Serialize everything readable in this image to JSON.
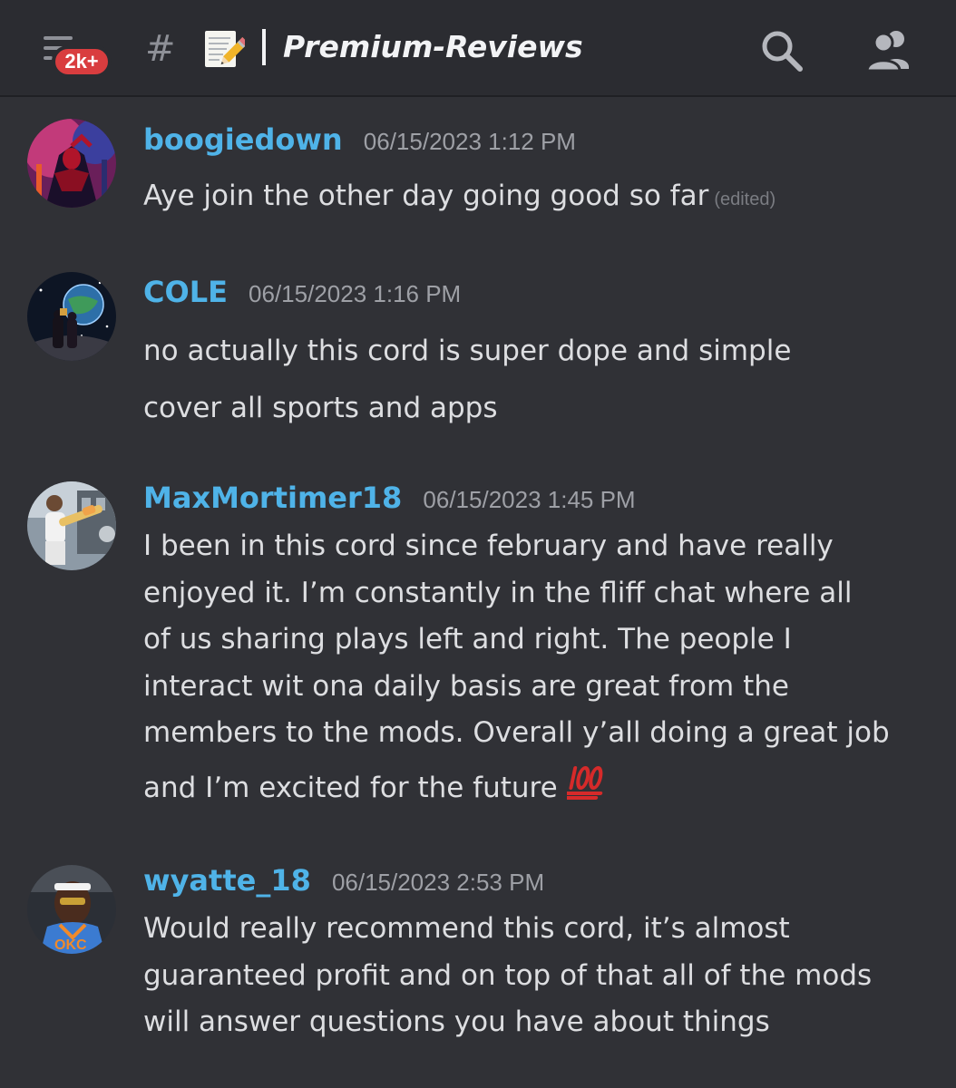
{
  "header": {
    "notification_badge": "2k+",
    "channel_prefix_icon": "hash-icon",
    "channel_emoji": "memo-icon",
    "channel_name": "Premium-Reviews",
    "search_icon": "search-icon",
    "members_icon": "members-icon"
  },
  "colors": {
    "background": "#303136",
    "header_background": "#2b2c31",
    "username": "#4fb3e8",
    "badge": "#d93d3f",
    "timestamp": "#9ea0a6",
    "text": "#dddee1"
  },
  "messages": [
    {
      "username": "boogiedown",
      "timestamp": "06/15/2023 1:12 PM",
      "lines": [
        "Aye join the other day going good so far"
      ],
      "edited": "(edited)"
    },
    {
      "username": "COLE",
      "timestamp": "06/15/2023 1:16 PM",
      "lines": [
        "no actually this cord is super dope and simple",
        "cover all sports and apps"
      ]
    },
    {
      "username": "MaxMortimer18",
      "timestamp": "06/15/2023 1:45 PM",
      "lines": [
        "I been in this cord since february and have really",
        "enjoyed it. I’m constantly in the fliff chat where all",
        "of us sharing plays left and right. The people I",
        "interact wit ona daily basis are great from the",
        "members to the mods. Overall y’all doing a great job",
        "and I’m excited for the future"
      ],
      "trailing_emoji": "hundred-points-icon"
    },
    {
      "username": "wyatte_18",
      "timestamp": "06/15/2023 2:53 PM",
      "lines": [
        "Would really recommend this cord, it’s almost",
        "guaranteed profit and on top of that all of the mods",
        "will answer questions you have about things"
      ]
    }
  ]
}
